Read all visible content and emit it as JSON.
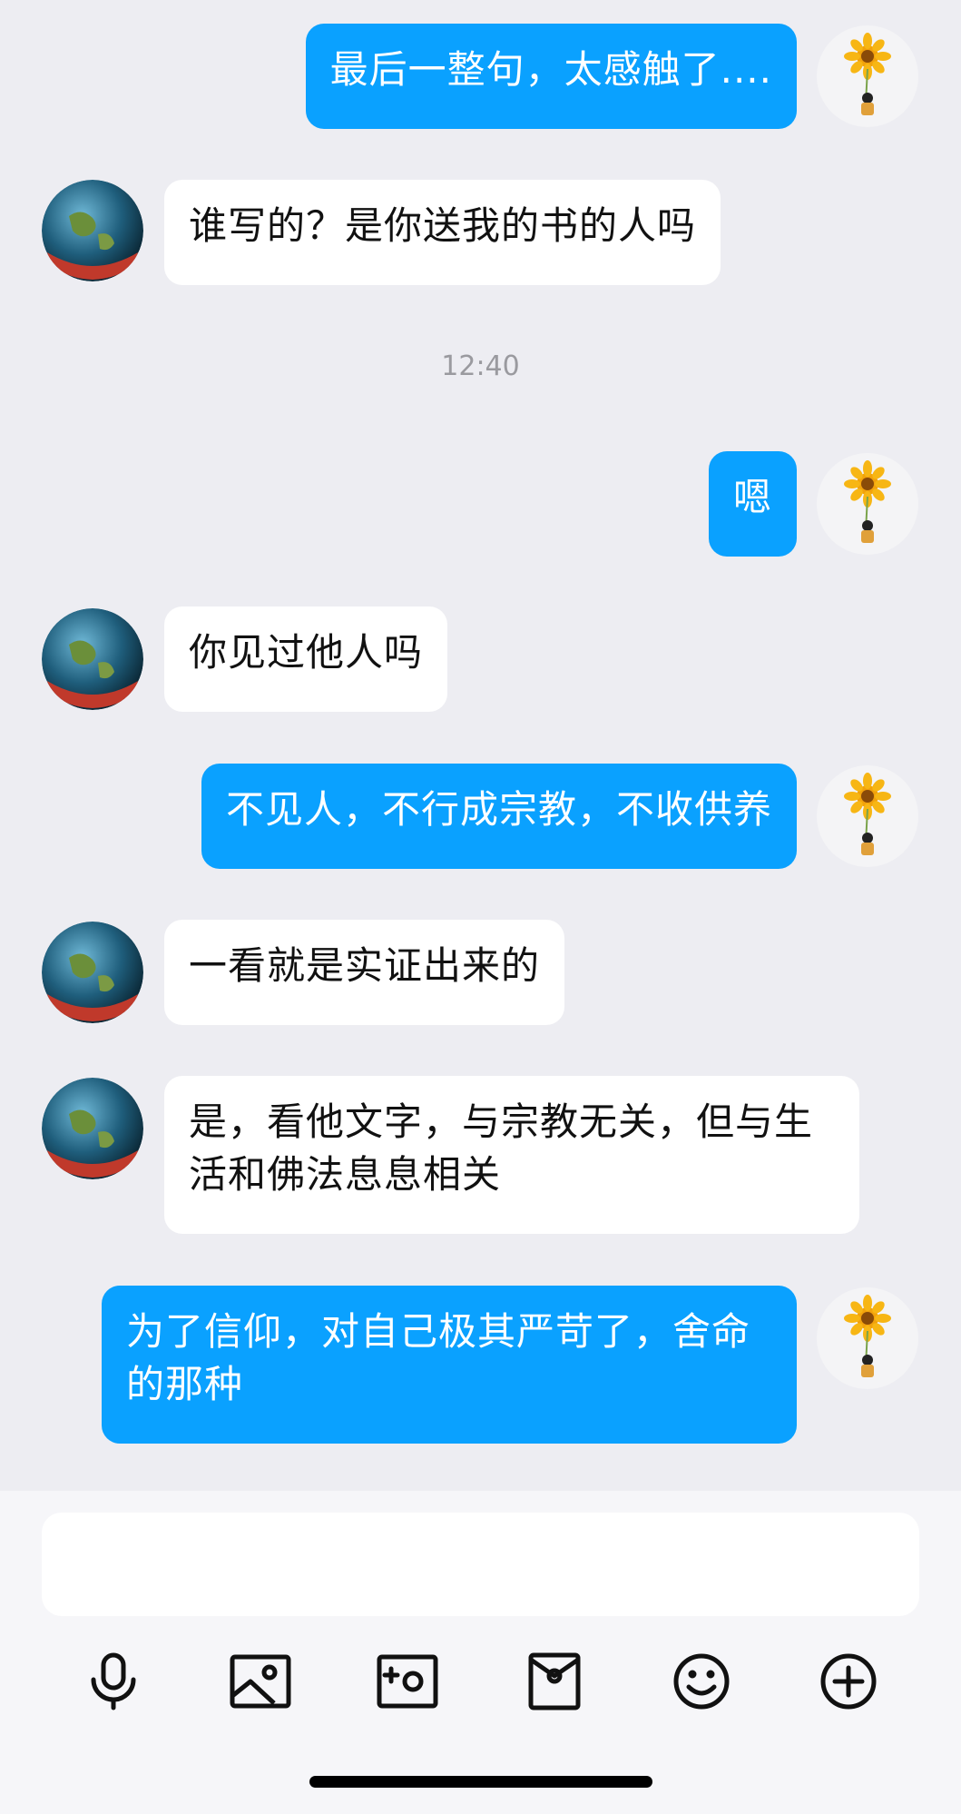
{
  "messages": [
    {
      "side": "me",
      "text": "最后一整句，太感触了...."
    },
    {
      "side": "other",
      "text": "谁写的？是你送我的书的人吗"
    },
    {
      "side": "me",
      "text": "嗯"
    },
    {
      "side": "other",
      "text": "你见过他人吗"
    },
    {
      "side": "me",
      "text": "不见人，不行成宗教，不收供养"
    },
    {
      "side": "other",
      "text": "一看就是实证出来的"
    },
    {
      "side": "other",
      "text": "是，看他文字，与宗教无关，但与生活和佛法息息相关"
    },
    {
      "side": "me",
      "text": "为了信仰，对自己极其严苛了，舍命的那种"
    }
  ],
  "timestamp": "12:40",
  "input": {
    "value": ""
  },
  "toolbar": [
    "microphone-icon",
    "image-icon",
    "camera-icon",
    "red-packet-icon",
    "emoji-icon",
    "plus-icon"
  ],
  "colors": {
    "accent": "#0aa1ff",
    "background": "#ededf2"
  }
}
